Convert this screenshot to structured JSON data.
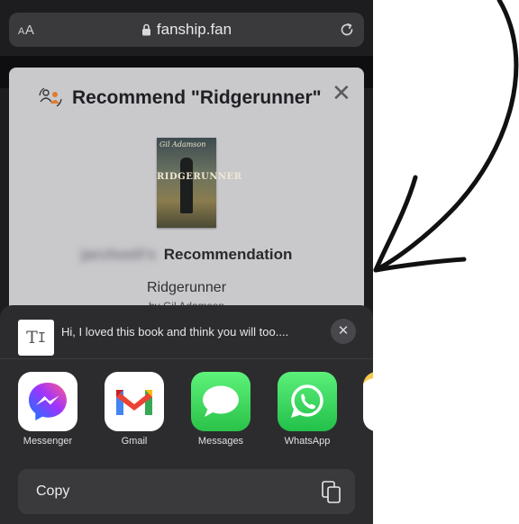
{
  "browser": {
    "text_size_label": "AA",
    "domain": "fanship.fan"
  },
  "modal": {
    "title": "Recommend \"Ridgerunner\"",
    "close_glyph": "✕",
    "book": {
      "cover_author": "Gil Adamson",
      "cover_title": "RIDGERUNNER"
    },
    "recommender_name": "jarchoeli's",
    "recommendation_label": "Recommendation",
    "book_title": "Ridgerunner",
    "byline": "by Gil Adamson"
  },
  "share_sheet": {
    "message_preview": "Hi, I loved this book and think you will too....",
    "close_glyph": "✕",
    "apps": [
      {
        "label": "Messenger",
        "icon": "messenger-icon"
      },
      {
        "label": "Gmail",
        "icon": "gmail-icon"
      },
      {
        "label": "Messages",
        "icon": "messages-icon"
      },
      {
        "label": "WhatsApp",
        "icon": "whatsapp-icon"
      }
    ],
    "copy_label": "Copy"
  },
  "colors": {
    "sheet_bg": "#2c2c2e",
    "modal_bg": "#c9c9cc",
    "messages_green": "#34c759",
    "whatsapp_green": "#25d366",
    "messenger_gradient": [
      "#0a7cff",
      "#a033ff",
      "#ff5c87"
    ]
  }
}
